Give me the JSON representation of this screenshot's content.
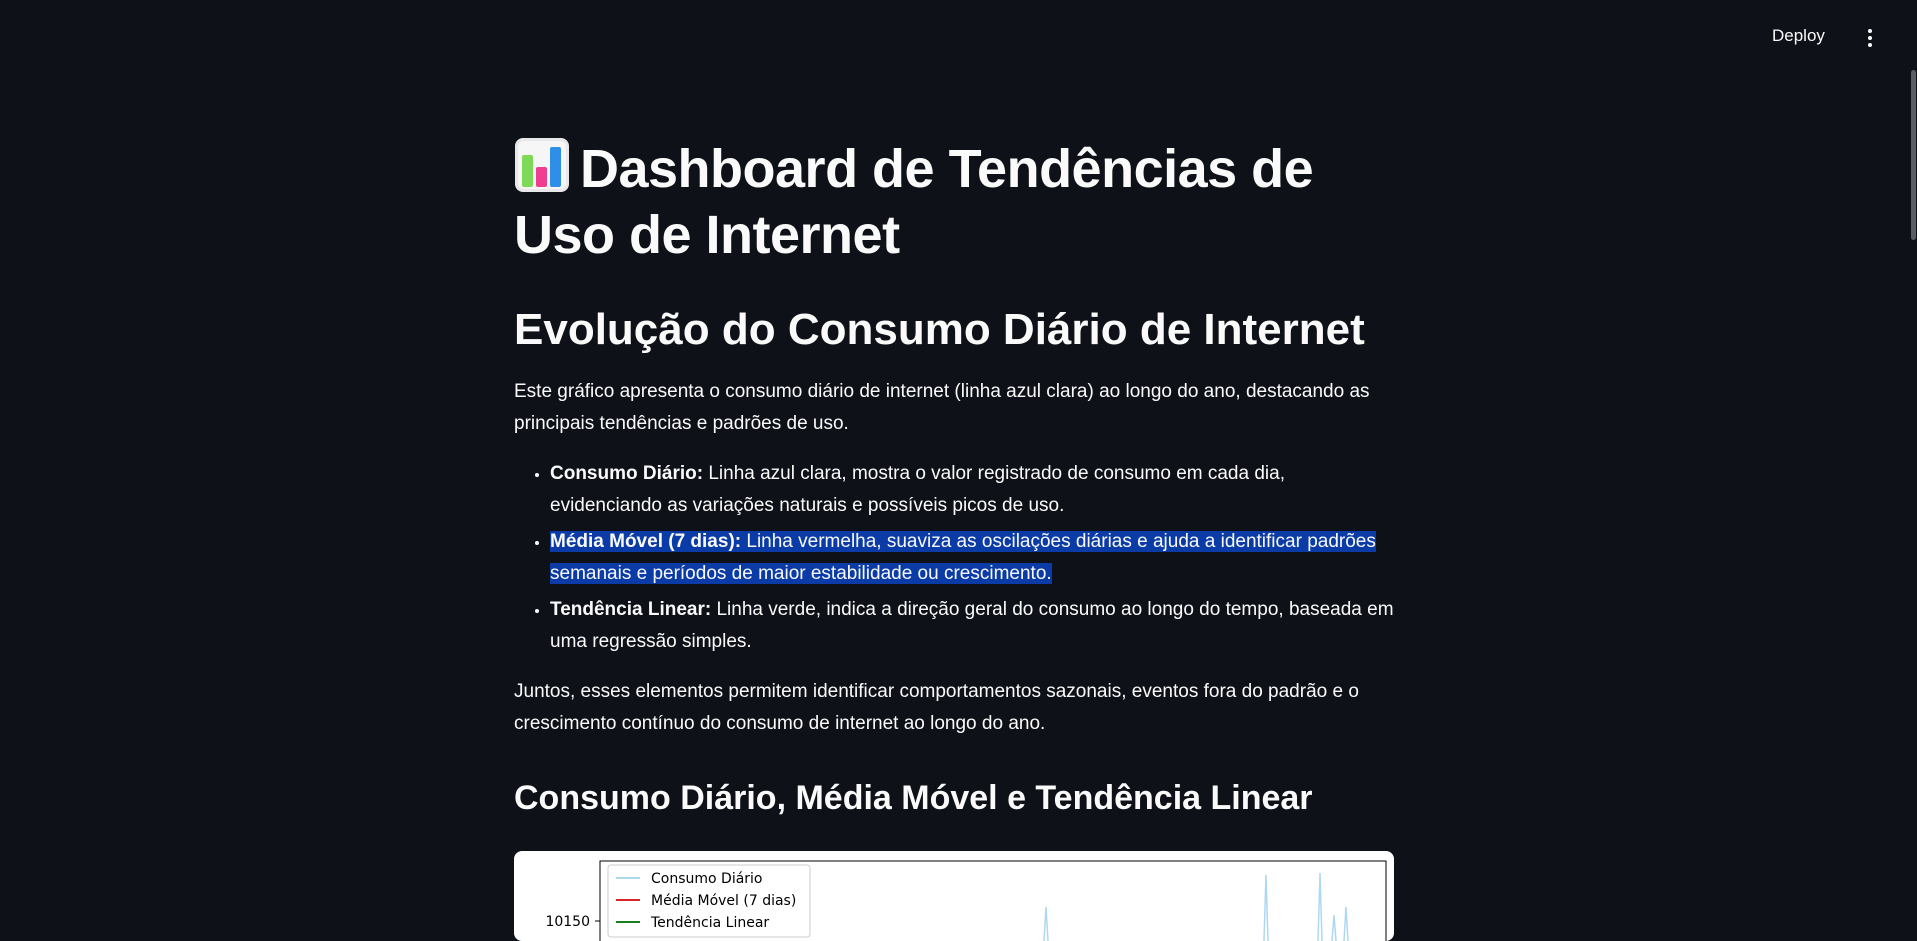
{
  "header": {
    "deploy_label": "Deploy",
    "menu_icon": "kebab-menu-icon"
  },
  "page": {
    "title_icon": "bar-chart-emoji",
    "title": "Dashboard de Tendências de Uso de Internet",
    "section_title": "Evolução do Consumo Diário de Internet",
    "intro": "Este gráfico apresenta o consumo diário de internet (linha azul clara) ao longo do ano, destacando as principais tendências e padrões de uso.",
    "bullets": [
      {
        "bold": "Consumo Diário:",
        "text": " Linha azul clara, mostra o valor registrado de consumo em cada dia, evidenciando as variações naturais e possíveis picos de uso."
      },
      {
        "bold": "Média Móvel (7 dias):",
        "text": " Linha vermelha, suaviza as oscilações diárias e ajuda a identificar padrões semanais e períodos de maior estabilidade ou crescimento."
      },
      {
        "bold": "Tendência Linear:",
        "text": " Linha verde, indica a direção geral do consumo ao longo do tempo, baseada em uma regressão simples."
      }
    ],
    "conclusion": "Juntos, esses elementos permitem identificar comportamentos sazonais, eventos fora do padrão e o crescimento contínuo do consumo de internet ao longo do ano.",
    "chart_heading": "Consumo Diário, Média Móvel e Tendência Linear"
  },
  "chart_data": {
    "type": "line",
    "legend": [
      "Consumo Diário",
      "Média Móvel (7 dias)",
      "Tendência Linear"
    ],
    "legend_colors": [
      "#aed8f0",
      "#d62728",
      "#1a7f1a"
    ],
    "legend_position": "top-left",
    "y_tick_labels": [
      "10150"
    ]
  }
}
